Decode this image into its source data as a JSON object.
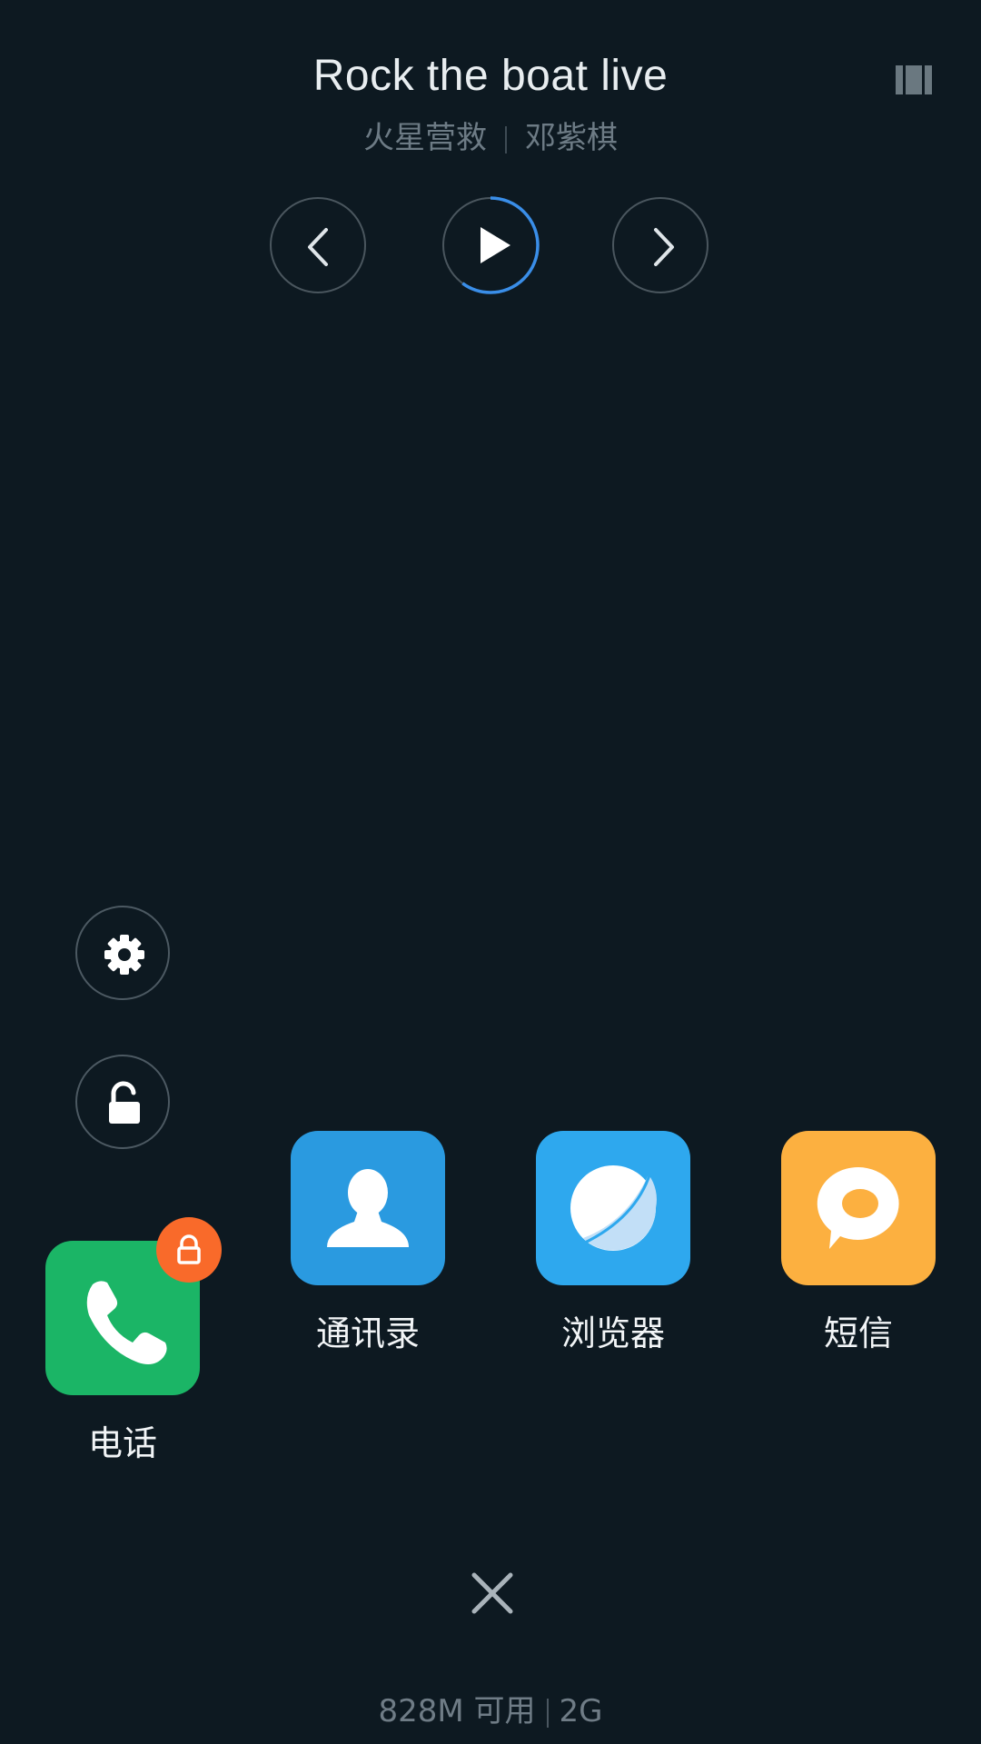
{
  "music": {
    "title": "Rock the boat live",
    "album": "火星营救",
    "artist": "邓紫棋",
    "progress_percent": 60
  },
  "icons": {
    "lyrics": "lyrics-view-icon",
    "prev": "chevron-left-icon",
    "play": "play-icon",
    "next": "chevron-right-icon",
    "settings": "gear-icon",
    "unlock": "unlocked-padlock-icon",
    "close": "close-icon",
    "lock_badge": "lock-icon"
  },
  "apps": [
    {
      "label": "电话",
      "icon": "phone-icon",
      "color": "#1bb566",
      "locked": true
    },
    {
      "label": "通讯录",
      "icon": "contact-person-icon",
      "color": "#2a9ae0",
      "locked": false
    },
    {
      "label": "浏览器",
      "icon": "planet-icon",
      "color": "#2ea8ee",
      "locked": false
    },
    {
      "label": "短信",
      "icon": "chat-bubble-icon",
      "color": "#fcb040",
      "locked": false
    }
  ],
  "colors": {
    "background": "#0d1921",
    "play_progress": "#3a8ee8",
    "lock_badge": "#f96a2a"
  },
  "footer": {
    "memory": "828M 可用",
    "ram": "2G"
  }
}
